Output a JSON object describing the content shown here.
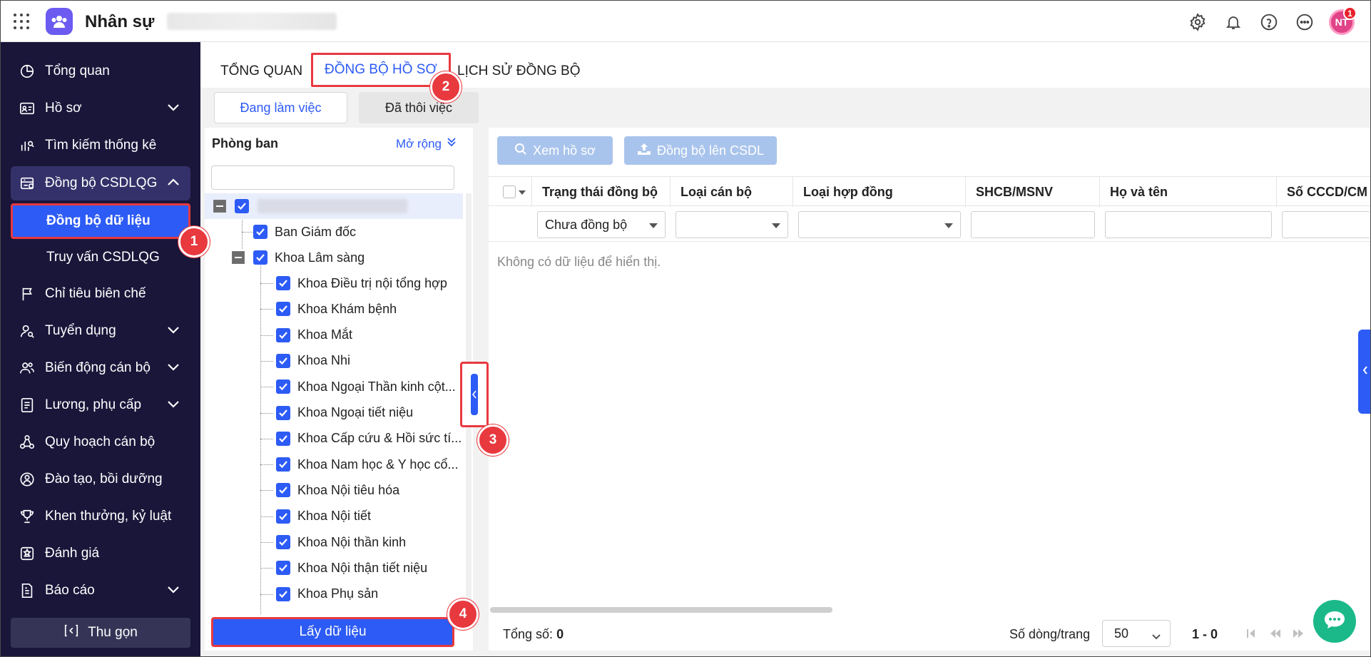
{
  "header": {
    "app_title": "Nhân sự",
    "avatar_initials": "NT",
    "notification_count": "1"
  },
  "sidebar": {
    "items": [
      {
        "label": "Tổng quan",
        "icon": "pie-chart-icon"
      },
      {
        "label": "Hồ sơ",
        "icon": "id-card-icon"
      },
      {
        "label": "Tìm kiếm thống kê",
        "icon": "chart-search-icon"
      },
      {
        "label": "Đồng bộ CSDLQG",
        "icon": "database-sync-icon"
      },
      {
        "label": "Chỉ tiêu biên chế",
        "icon": "flag-icon"
      },
      {
        "label": "Tuyển dụng",
        "icon": "user-search-icon"
      },
      {
        "label": "Biến động cán bộ",
        "icon": "users-icon"
      },
      {
        "label": "Lương, phụ cấp",
        "icon": "document-icon"
      },
      {
        "label": "Quy hoạch cán bộ",
        "icon": "org-chart-icon"
      },
      {
        "label": "Đào tạo, bồi dưỡng",
        "icon": "training-icon"
      },
      {
        "label": "Khen thưởng, kỷ luật",
        "icon": "trophy-icon"
      },
      {
        "label": "Đánh giá",
        "icon": "rating-icon"
      },
      {
        "label": "Báo cáo",
        "icon": "report-icon"
      }
    ],
    "sub_items": {
      "sync_data": "Đồng bộ dữ liệu",
      "query_csdlqg": "Truy vấn CSDLQG"
    },
    "collapse_label": "Thu gọn"
  },
  "tabs": {
    "overview": "TỔNG QUAN",
    "sync_profile": "ĐỒNG BỘ HỒ SƠ",
    "sync_history": "LỊCH SỬ ĐỒNG BỘ"
  },
  "subtabs": {
    "working": "Đang làm việc",
    "retired": "Đã thôi việc"
  },
  "left_panel": {
    "title": "Phòng ban",
    "expand": "Mở rộng",
    "tree": {
      "level1": "Ban Giám đốc",
      "clinical": "Khoa Lâm sàng",
      "children": [
        "Khoa Điều trị nội tổng hợp",
        "Khoa Khám bệnh",
        "Khoa Mắt",
        "Khoa Nhi",
        "Khoa Ngoại Thần kinh cột...",
        "Khoa Ngoại tiết niệu",
        "Khoa Cấp cứu & Hồi sức tí...",
        "Khoa Nam học & Y học cổ...",
        "Khoa Nội tiêu hóa",
        "Khoa Nội tiết",
        "Khoa Nội thần kinh",
        "Khoa Nội thận tiết niệu",
        "Khoa Phụ sản"
      ]
    },
    "get_data": "Lấy dữ liệu"
  },
  "toolbar": {
    "view_profile": "Xem hồ sơ",
    "sync_upload": "Đồng bộ lên CSDL"
  },
  "grid": {
    "columns": [
      "Trạng thái đồng bộ",
      "Loại cán bộ",
      "Loại hợp đồng",
      "SHCB/MSNV",
      "Họ và tên",
      "Số CCCD/CM"
    ],
    "status_filter": "Chưa đồng bộ",
    "empty": "Không có dữ liệu để hiển thị."
  },
  "footer": {
    "total_label": "Tổng số:",
    "total_value": "0",
    "rows_label": "Số dòng/trang",
    "page_size": "50",
    "range": "1 - 0"
  },
  "badges": {
    "b1": "1",
    "b2": "2",
    "b3": "3",
    "b4": "4"
  },
  "colors": {
    "primary": "#2d5bf5",
    "sidebar_bg": "#19163a",
    "highlight": "#e8393f"
  }
}
